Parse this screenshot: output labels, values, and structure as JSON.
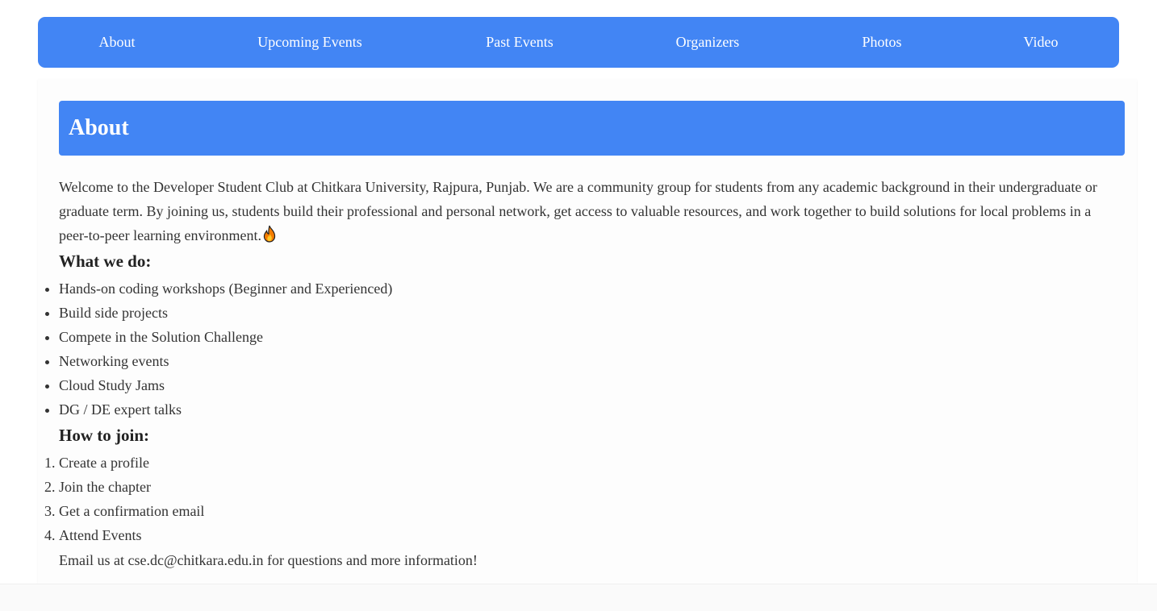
{
  "nav": {
    "items": [
      {
        "label": "About"
      },
      {
        "label": "Upcoming Events"
      },
      {
        "label": "Past Events"
      },
      {
        "label": "Organizers"
      },
      {
        "label": "Photos"
      },
      {
        "label": "Video"
      }
    ]
  },
  "about": {
    "title": "About",
    "intro": "Welcome to the Developer Student Club at Chitkara University, Rajpura, Punjab. We are a community group for students from any academic background in their undergraduate or graduate term. By joining us, students build their professional and personal network, get access to valuable resources, and work together to build solutions for local problems in a peer-to-peer learning environment.",
    "intro_icon": "fire-icon",
    "what_heading": "What we do:",
    "what_items": [
      "Hands-on coding workshops (Beginner and Experienced)",
      "Build side projects",
      "Compete in the Solution Challenge",
      "Networking events",
      "Cloud Study Jams",
      "DG / DE expert talks"
    ],
    "join_heading": "How to join:",
    "join_steps": [
      "Create a profile",
      "Join the chapter",
      "Get a confirmation email",
      "Attend Events"
    ],
    "contact": "Email us at cse.dc@chitkara.edu.in for questions and more information!"
  },
  "colors": {
    "accent": "#4285f4",
    "text": "#333333",
    "heading_text": "#ffffff"
  }
}
